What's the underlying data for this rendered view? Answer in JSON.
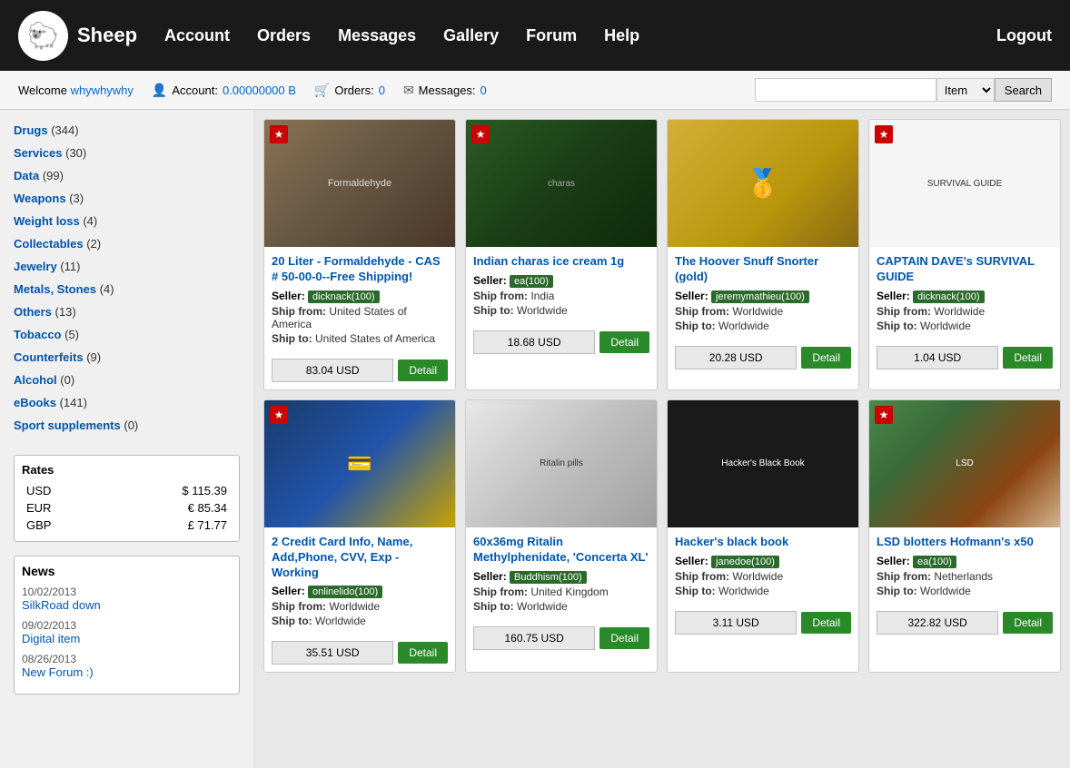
{
  "header": {
    "logo_text": "Sheep",
    "logo_icon": "🐑",
    "nav": [
      {
        "label": "Account",
        "href": "#"
      },
      {
        "label": "Orders",
        "href": "#"
      },
      {
        "label": "Messages",
        "href": "#"
      },
      {
        "label": "Gallery",
        "href": "#"
      },
      {
        "label": "Forum",
        "href": "#"
      },
      {
        "label": "Help",
        "href": "#"
      }
    ],
    "logout_label": "Logout"
  },
  "subheader": {
    "welcome_text": "Welcome",
    "username": "whywhywhy",
    "account_label": "Account:",
    "account_balance": "0.00000000 B",
    "orders_label": "Orders:",
    "orders_count": "0",
    "messages_label": "Messages:",
    "messages_count": "0",
    "search_placeholder": "",
    "search_option": "Item",
    "search_btn": "Search"
  },
  "sidebar": {
    "categories": [
      {
        "label": "Drugs",
        "count": "(344)"
      },
      {
        "label": "Services",
        "count": "(30)"
      },
      {
        "label": "Data",
        "count": "(99)"
      },
      {
        "label": "Weapons",
        "count": "(3)"
      },
      {
        "label": "Weight loss",
        "count": "(4)"
      },
      {
        "label": "Collectables",
        "count": "(2)"
      },
      {
        "label": "Jewelry",
        "count": "(11)"
      },
      {
        "label": "Metals, Stones",
        "count": "(4)"
      },
      {
        "label": "Others",
        "count": "(13)"
      },
      {
        "label": "Tobacco",
        "count": "(5)"
      },
      {
        "label": "Counterfeits",
        "count": "(9)"
      },
      {
        "label": "Alcohol",
        "count": "(0)"
      },
      {
        "label": "eBooks",
        "count": "(141)"
      },
      {
        "label": "Sport supplements",
        "count": "(0)"
      }
    ],
    "rates": {
      "title": "Rates",
      "rows": [
        {
          "currency": "USD",
          "value": "$ 115.39"
        },
        {
          "currency": "EUR",
          "value": "€ 85.34"
        },
        {
          "currency": "GBP",
          "value": "£ 71.77"
        }
      ]
    },
    "news": {
      "title": "News",
      "items": [
        {
          "date": "10/02/2013",
          "label": "SilkRoad down",
          "href": "#"
        },
        {
          "date": "09/02/2013",
          "label": "Digital item",
          "href": "#"
        },
        {
          "date": "08/26/2013",
          "label": "New Forum :)",
          "href": "#"
        }
      ]
    }
  },
  "products": [
    {
      "id": "p1",
      "featured": true,
      "title": "20 Liter - Formaldehyde - CAS # 50-00-0--Free Shipping!",
      "seller": "dicknack(100)",
      "seller_color": "#2a6a2a",
      "ship_from": "United States of America",
      "ship_to": "United States of America",
      "price": "83.04 USD",
      "img_type": "formaldehyde",
      "img_label": "Formaldehyde"
    },
    {
      "id": "p2",
      "featured": true,
      "title": "Indian charas ice cream 1g",
      "seller": "ea(100)",
      "seller_color": "#2a6a2a",
      "ship_from": "India",
      "ship_to": "Worldwide",
      "price": "18.68 USD",
      "img_type": "charas",
      "img_label": "charas"
    },
    {
      "id": "p3",
      "featured": false,
      "title": "The Hoover Snuff Snorter (gold)",
      "seller": "jeremymathieu(100)",
      "seller_color": "#2a6a2a",
      "ship_from": "Worldwide",
      "ship_to": "Worldwide",
      "price": "20.28 USD",
      "img_type": "hoover",
      "img_label": "🥇"
    },
    {
      "id": "p4",
      "featured": true,
      "title": "CAPTAIN DAVE's SURVIVAL GUIDE",
      "seller": "dicknack(100)",
      "seller_color": "#2a6a2a",
      "ship_from": "Worldwide",
      "ship_to": "Worldwide",
      "price": "1.04 USD",
      "img_type": "survival",
      "img_label": "SURVIVAL GUIDE"
    },
    {
      "id": "p5",
      "featured": true,
      "title": "2 Credit Card Info, Name, Add,Phone, CVV, Exp - Working",
      "seller": "onlinelido(100)",
      "seller_color": "#2a6a2a",
      "ship_from": "Worldwide",
      "ship_to": "Worldwide",
      "price": "35.51 USD",
      "img_type": "creditcard",
      "img_label": "💳"
    },
    {
      "id": "p6",
      "featured": false,
      "title": "60x36mg Ritalin Methylphenidate, 'Concerta XL'",
      "seller": "Buddhism(100)",
      "seller_color": "#2a6a2a",
      "ship_from": "United Kingdom",
      "ship_to": "Worldwide",
      "price": "160.75 USD",
      "img_type": "ritalin",
      "img_label": "Ritalin pills"
    },
    {
      "id": "p7",
      "featured": false,
      "title": "Hacker's black book",
      "seller": "janedoe(100)",
      "seller_color": "#2a6a2a",
      "ship_from": "Worldwide",
      "ship_to": "Worldwide",
      "price": "3.11 USD",
      "img_type": "blackbook",
      "img_label": "Hacker's\nBlack Book"
    },
    {
      "id": "p8",
      "featured": true,
      "title": "LSD blotters Hofmann's x50",
      "seller": "ea(100)",
      "seller_color": "#2a6a2a",
      "ship_from": "Netherlands",
      "ship_to": "Worldwide",
      "price": "322.82 USD",
      "img_type": "lsd",
      "img_label": "LSD"
    }
  ],
  "labels": {
    "seller_prefix": "Seller:",
    "ship_from": "Ship from:",
    "ship_to": "Ship to:",
    "detail_btn": "Detail",
    "featured_star": "★"
  }
}
